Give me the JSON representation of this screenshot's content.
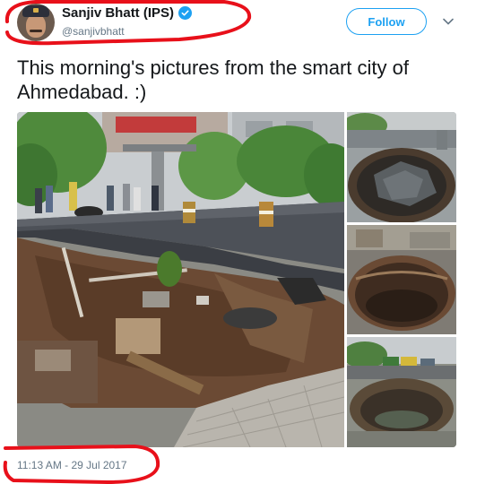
{
  "tweet": {
    "display_name": "Sanjiv Bhatt (IPS)",
    "handle": "@sanjivbhatt",
    "verified": true,
    "text": "This morning's pictures from the smart city of Ahmedabad. :)",
    "timestamp": "11:13 AM - 29 Jul 2017"
  },
  "actions": {
    "follow_label": "Follow"
  },
  "icons": {
    "verified": "verified-badge-icon",
    "caret": "chevron-down-icon"
  },
  "colors": {
    "accent": "#1da1f2",
    "annotation": "#e8101a",
    "text": "#14171a",
    "secondary_text": "#657786"
  }
}
